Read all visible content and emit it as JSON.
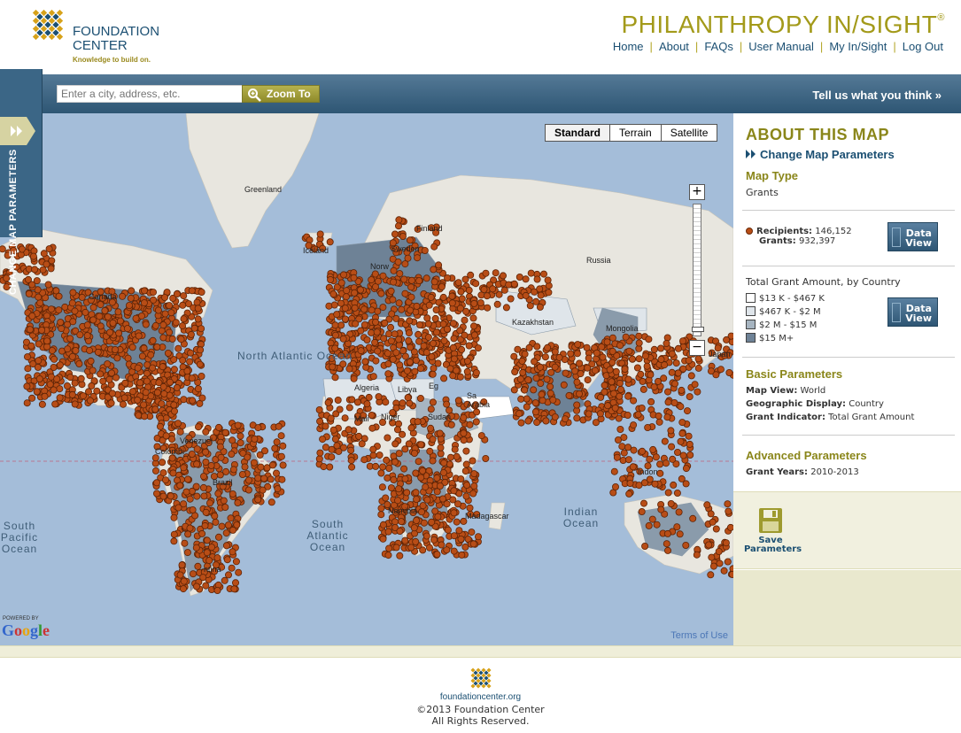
{
  "header": {
    "logo_line1": "FOUNDATION",
    "logo_line2": "CENTER",
    "logo_tagline": "Knowledge to build on.",
    "brand": "PHILANTHROPY IN/SIGHT",
    "brand_mark": "®",
    "nav": [
      "Home",
      "About",
      "FAQs",
      "User Manual",
      "My In/Sight",
      "Log Out"
    ]
  },
  "search": {
    "placeholder": "Enter a city, address, etc.",
    "button_label": "Zoom To",
    "feedback_link": "Tell us what you think »"
  },
  "sidetab": {
    "label": "CHANGE MAP PARAMETERS"
  },
  "map": {
    "types": [
      "Standard",
      "Terrain",
      "Satellite"
    ],
    "active_type": "Standard",
    "zoom_in": "+",
    "zoom_out": "−",
    "ocean_labels": {
      "north_atlantic": "North Atlantic Ocean",
      "south_atlantic": "South Atlantic Ocean",
      "south_pacific": "South Pacific Ocean",
      "indian": "Indian Ocean"
    },
    "land_labels": {
      "greenland": "Greenland",
      "canada": "Canada",
      "russia": "Russia",
      "kazakhstan": "Kazakhstan",
      "mongolia": "Mongolia",
      "finland": "Finland",
      "sweden": "Sweden",
      "norway": "Norw",
      "iceland": "Iceland",
      "algeria": "Algeria",
      "libya": "Libya",
      "egypt": "Eg",
      "mali": "Mali",
      "niger": "Niger",
      "sudan": "Sudan",
      "saudi": "Sa Arabia",
      "brazil": "Brazil",
      "colombia": "Colombi",
      "venezuela": "Venezuel",
      "namibia": "Namibia",
      "madagascar": "Madagascar",
      "japan": "Japan",
      "indonesia": "Indon",
      "argentina": "ntina"
    },
    "powered_by": "POWERED BY",
    "google": "Google",
    "terms": "Terms of Use",
    "marker_color": "#b84d16"
  },
  "panel": {
    "title": "ABOUT THIS MAP",
    "change_link": "Change Map Parameters",
    "map_type_head": "Map Type",
    "map_type_value": "Grants",
    "recipients_label": "Recipients:",
    "recipients_value": "146,152",
    "grants_label": "Grants:",
    "grants_value": "932,397",
    "data_view_line1": "Data",
    "data_view_line2": "View",
    "legend_head": "Total Grant Amount, by Country",
    "legend": [
      {
        "label": "$13 K - $467 K",
        "color": "#ffffff"
      },
      {
        "label": "$467 K - $2 M",
        "color": "#dfe5ea"
      },
      {
        "label": "$2 M - $15 M",
        "color": "#a7b5c1"
      },
      {
        "label": "$15 M+",
        "color": "#6e8296"
      }
    ],
    "basic_head": "Basic Parameters",
    "basic": [
      {
        "key": "Map View:",
        "value": "World"
      },
      {
        "key": "Geographic Display:",
        "value": "Country"
      },
      {
        "key": "Grant Indicator:",
        "value": "Total Grant Amount"
      }
    ],
    "advanced_head": "Advanced Parameters",
    "advanced": [
      {
        "key": "Grant Years:",
        "value": "2010-2013"
      }
    ],
    "save_line1": "Save",
    "save_line2": "Parameters"
  },
  "footer": {
    "site": "foundationcenter.org",
    "copyright": "©2013 Foundation Center",
    "rights": "All Rights Reserved."
  }
}
